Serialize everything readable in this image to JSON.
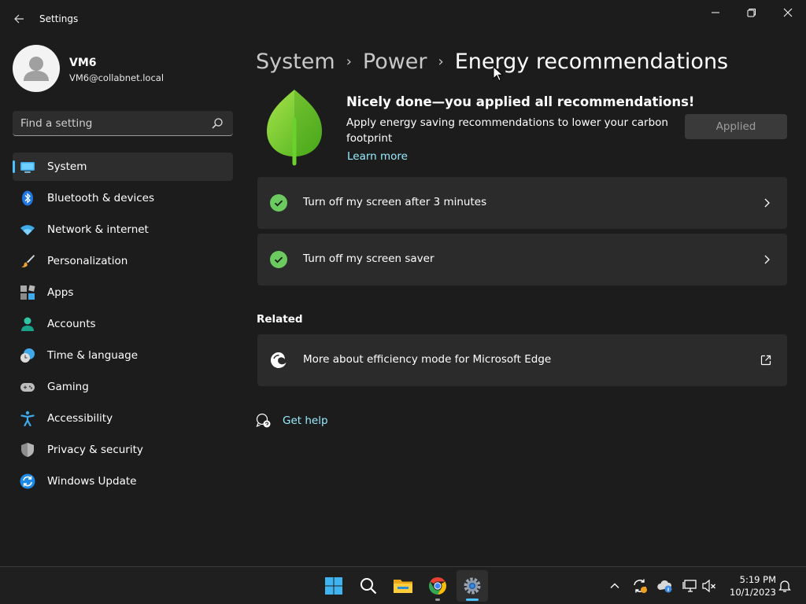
{
  "window": {
    "title": "Settings"
  },
  "profile": {
    "name": "VM6",
    "email": "VM6@collabnet.local"
  },
  "search": {
    "placeholder": "Find a setting"
  },
  "sidebar": {
    "items": [
      {
        "label": "System",
        "icon": "system-icon",
        "selected": true
      },
      {
        "label": "Bluetooth & devices",
        "icon": "bluetooth-icon"
      },
      {
        "label": "Network & internet",
        "icon": "wifi-icon"
      },
      {
        "label": "Personalization",
        "icon": "brush-icon"
      },
      {
        "label": "Apps",
        "icon": "apps-icon"
      },
      {
        "label": "Accounts",
        "icon": "accounts-icon"
      },
      {
        "label": "Time & language",
        "icon": "clock-globe-icon"
      },
      {
        "label": "Gaming",
        "icon": "gamepad-icon"
      },
      {
        "label": "Accessibility",
        "icon": "accessibility-icon"
      },
      {
        "label": "Privacy & security",
        "icon": "shield-icon"
      },
      {
        "label": "Windows Update",
        "icon": "update-icon"
      }
    ]
  },
  "breadcrumb": {
    "items": [
      "System",
      "Power"
    ],
    "current": "Energy recommendations"
  },
  "hero": {
    "title": "Nicely done—you applied all recommendations!",
    "description": "Apply energy saving recommendations to lower your carbon footprint",
    "link": "Learn more",
    "button": "Applied"
  },
  "recommendations": [
    {
      "label": "Turn off my screen after 3 minutes",
      "status": "applied"
    },
    {
      "label": "Turn off my screen saver",
      "status": "applied"
    }
  ],
  "related": {
    "title": "Related",
    "items": [
      {
        "label": "More about efficiency mode for Microsoft Edge",
        "icon": "edge-icon"
      }
    ]
  },
  "help": {
    "label": "Get help"
  },
  "taskbar": {
    "apps": [
      "start-icon",
      "search-icon",
      "file-explorer-icon",
      "chrome-icon",
      "settings-icon"
    ],
    "time": "5:19 PM",
    "date": "10/1/2023"
  },
  "colors": {
    "accent": "#4cc2ff",
    "link": "#99ebff",
    "check": "#6ccb5f",
    "leaf": "#7ed321",
    "background": "#1c1c1c",
    "card": "#2b2b2b"
  }
}
